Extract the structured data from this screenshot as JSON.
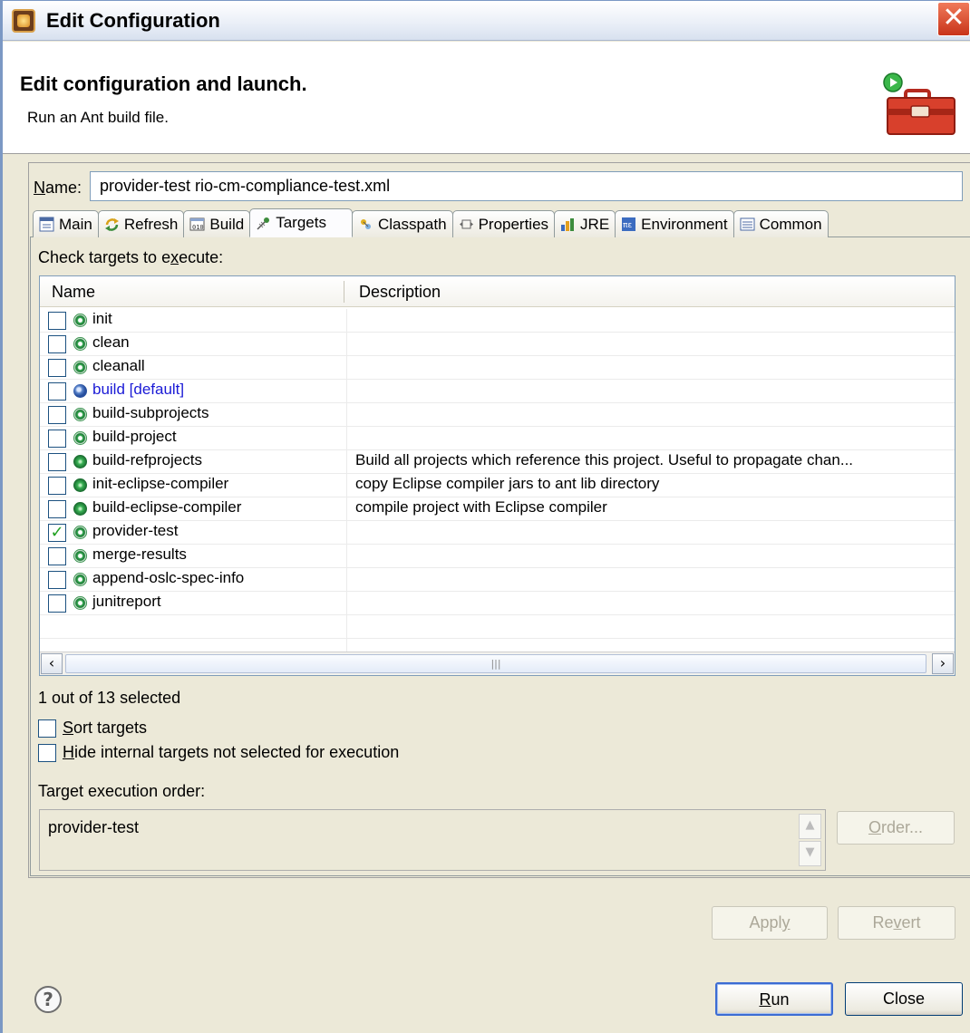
{
  "window": {
    "title": "Edit Configuration"
  },
  "header": {
    "title": "Edit configuration and launch.",
    "subtitle": "Run an Ant build file."
  },
  "name_field": {
    "label": "Name:",
    "value": "provider-test rio-cm-compliance-test.xml"
  },
  "tabs": [
    {
      "label": "Main",
      "icon": "main-tab-icon"
    },
    {
      "label": "Refresh",
      "icon": "refresh-icon"
    },
    {
      "label": "Build",
      "icon": "build-icon"
    },
    {
      "label": "Targets",
      "icon": "targets-icon",
      "active": true
    },
    {
      "label": "Classpath",
      "icon": "classpath-icon"
    },
    {
      "label": "Properties",
      "icon": "properties-icon"
    },
    {
      "label": "JRE",
      "icon": "jre-icon"
    },
    {
      "label": "Environment",
      "icon": "environment-icon"
    },
    {
      "label": "Common",
      "icon": "common-icon"
    }
  ],
  "targets_tab": {
    "check_label": "Check targets to execute:",
    "columns": {
      "name": "Name",
      "description": "Description"
    },
    "rows": [
      {
        "name": "init",
        "description": "",
        "checked": false
      },
      {
        "name": "clean",
        "description": "",
        "checked": false
      },
      {
        "name": "cleanall",
        "description": "",
        "checked": false
      },
      {
        "name": "build [default]",
        "description": "",
        "checked": false
      },
      {
        "name": "build-subprojects",
        "description": "",
        "checked": false
      },
      {
        "name": "build-project",
        "description": "",
        "checked": false
      },
      {
        "name": "build-refprojects",
        "description": "Build all projects which reference this project. Useful to propagate chan...",
        "checked": false
      },
      {
        "name": "init-eclipse-compiler",
        "description": "copy Eclipse compiler jars to ant lib directory",
        "checked": false
      },
      {
        "name": "build-eclipse-compiler",
        "description": "compile project with Eclipse compiler",
        "checked": false
      },
      {
        "name": "provider-test",
        "description": "",
        "checked": true
      },
      {
        "name": "merge-results",
        "description": "",
        "checked": false
      },
      {
        "name": "append-oslc-spec-info",
        "description": "",
        "checked": false
      },
      {
        "name": "junitreport",
        "description": "",
        "checked": false
      }
    ],
    "selection_status": "1 out of 13 selected",
    "sort_targets_label": "Sort targets",
    "hide_internal_label": "Hide internal targets not selected for execution",
    "order_label": "Target execution order:",
    "order_value": "provider-test",
    "order_button": "Order..."
  },
  "buttons": {
    "apply": "Apply",
    "revert": "Revert",
    "run": "Run",
    "close": "Close"
  },
  "colors": {
    "default_target_text": "#1a1ad6",
    "check_mark": "#21a121",
    "panel_bg": "#ece9d8"
  }
}
